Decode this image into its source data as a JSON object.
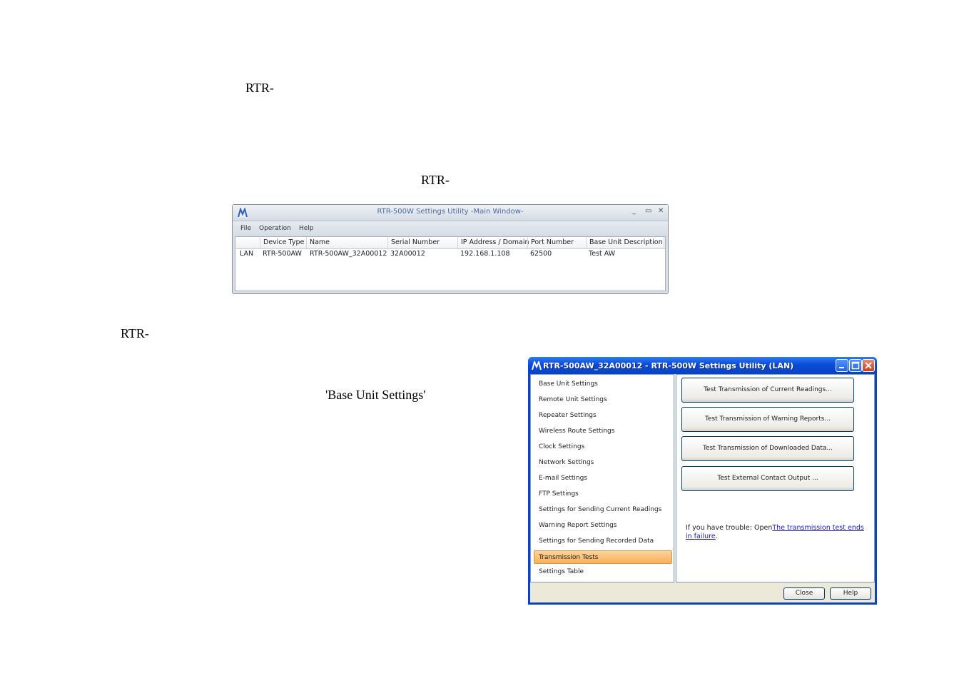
{
  "document": {
    "line1": "RTR-",
    "line2": "RTR-",
    "line3": "RTR-",
    "line4": "'Base Unit Settings'"
  },
  "main_window": {
    "title": "RTR-500W Settings Utility -Main Window-",
    "controls": {
      "minimize": "_",
      "maximize": "▭",
      "close": "✕"
    },
    "menu": [
      "File",
      "Operation",
      "Help"
    ],
    "table": {
      "columns": [
        "",
        "Device Type",
        "Name",
        "Serial Number",
        "IP Address / Domain",
        "Port Number",
        "Base Unit Description"
      ],
      "rows": [
        [
          "LAN",
          "RTR-500AW",
          "RTR-500AW_32A00012",
          "32A00012",
          "192.168.1.108",
          "62500",
          "Test AW"
        ]
      ]
    }
  },
  "settings_dialog": {
    "title": "RTR-500AW_32A00012 - RTR-500W Settings Utility (LAN)",
    "nav": [
      "Base Unit Settings",
      "Remote Unit Settings",
      "Repeater Settings",
      "Wireless Route Settings",
      "Clock Settings",
      "Network Settings",
      "E-mail Settings",
      "FTP Settings",
      "Settings for Sending Current Readings",
      "Warning Report Settings",
      "Settings for Sending Recorded Data",
      "Transmission Tests",
      "Settings Table"
    ],
    "active_nav": "Transmission Tests",
    "buttons": [
      "Test Transmission of Current Readings...",
      "Test Transmission of Warning Reports...",
      "Test Transmission of Downloaded Data...",
      "Test External Contact Output ..."
    ],
    "help_prefix": "If you have trouble: Open",
    "help_link": "The transmission test ends in failure",
    "help_suffix": ".",
    "footer": {
      "close": "Close",
      "help": "Help"
    },
    "colors": {
      "titlebar": "#0a4bd8",
      "active_nav": "#f7b15b",
      "client": "#ece9d8"
    }
  }
}
